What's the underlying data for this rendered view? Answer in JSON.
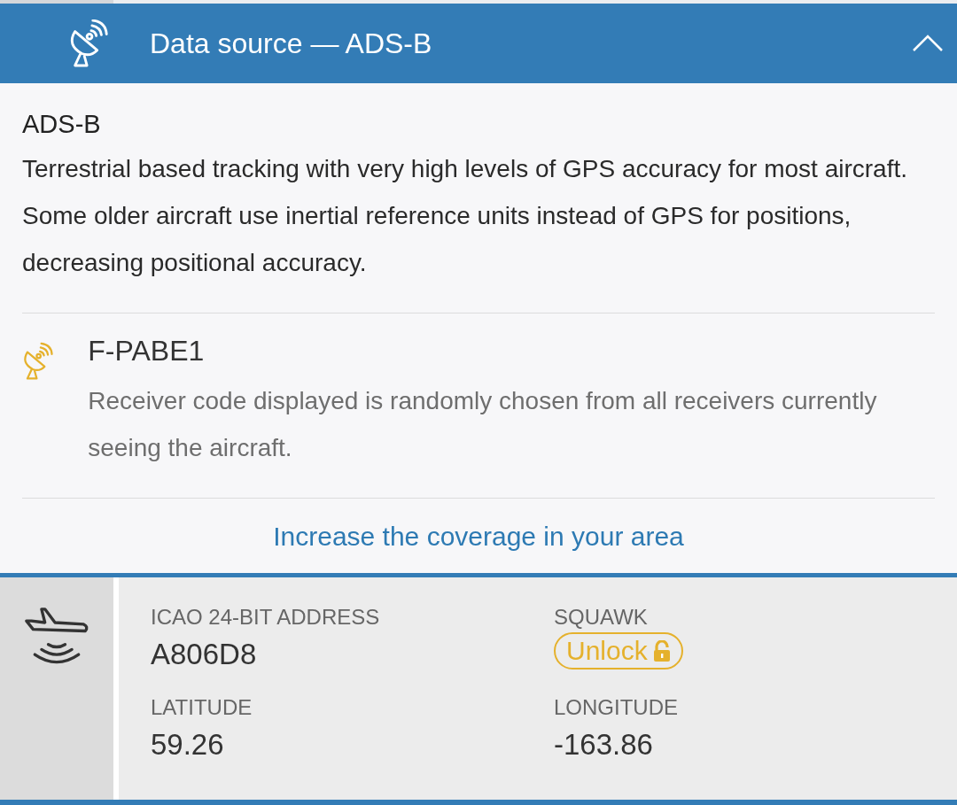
{
  "header": {
    "title": "Data source — ADS-B",
    "expanded": true
  },
  "source": {
    "name": "ADS-B",
    "description": "Terrestrial based tracking with very high levels of GPS accuracy for most aircraft. Some older aircraft use inertial reference units instead of GPS for positions, decreasing positional accuracy."
  },
  "receiver": {
    "code": "F-PABE1",
    "note": "Receiver code displayed is randomly chosen from all receivers currently seeing the aircraft."
  },
  "coverage_link": "Increase the coverage in your area",
  "fields": [
    {
      "label": "ICAO 24-BIT ADDRESS",
      "kind": "text",
      "value": "A806D8"
    },
    {
      "label": "SQUAWK",
      "kind": "locked",
      "value": "Unlock"
    },
    {
      "label": "LATITUDE",
      "kind": "text",
      "value": "59.26"
    },
    {
      "label": "LONGITUDE",
      "kind": "text",
      "value": "-163.86"
    }
  ]
}
